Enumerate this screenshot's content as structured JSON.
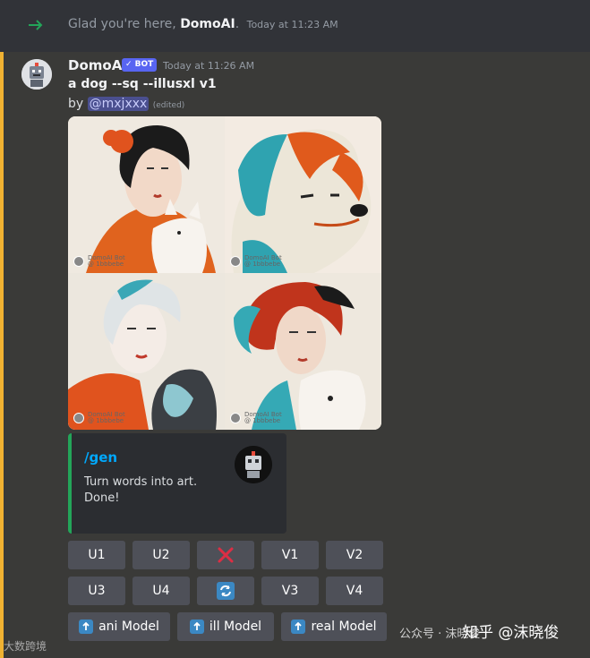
{
  "system_message": {
    "prefix": "Glad you're here, ",
    "name": "DomoAI",
    "suffix": ".",
    "time": "Today at 11:23 AM"
  },
  "bot_message": {
    "username": "DomoAI",
    "bot_tag": "✓ BOT",
    "time": "Today at 11:26 AM",
    "prompt": "a dog --sq --illusxl v1",
    "by_label": "by",
    "mention": "@mxjxxx",
    "edited": "(edited)"
  },
  "image_watermark": {
    "title": "DomoAI Bot",
    "sub": "@ 1bbbebe"
  },
  "embed": {
    "title": "/gen",
    "line1": "Turn words into art.",
    "line2": "Done!"
  },
  "buttons": {
    "row1": [
      "U1",
      "U2",
      "",
      "V1",
      "V2"
    ],
    "row2": [
      "U3",
      "U4",
      "",
      "V3",
      "V4"
    ],
    "models": [
      "ani Model",
      "ill Model",
      "real Model"
    ],
    "icon_names": {
      "cancel": "red-x-icon",
      "reroll": "refresh-icon",
      "model": "arrow-up-icon"
    }
  },
  "watermarks": {
    "zhihu": "知乎 @沫晓俊",
    "wechat": "公众号 · 沫晓俊",
    "corner": "大数跨境"
  },
  "colors": {
    "accent": "#5865f2",
    "link": "#00a8fc",
    "embed_border": "#23a559",
    "mention_bar": "#f0b232"
  }
}
